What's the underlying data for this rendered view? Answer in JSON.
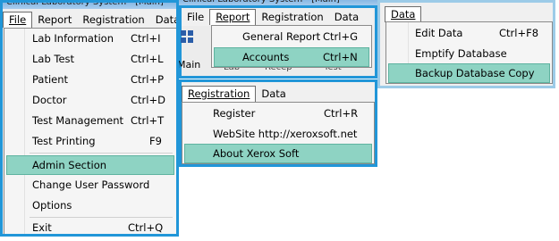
{
  "window": {
    "title": "Clinical Laboratory System - [Main]"
  },
  "menubar": {
    "file": "File",
    "report": "Report",
    "registration": "Registration",
    "data": "Data"
  },
  "file_menu": {
    "items": [
      {
        "label": "Lab Information",
        "shortcut": "Ctrl+I"
      },
      {
        "label": "Lab Test",
        "shortcut": "Ctrl+L"
      },
      {
        "label": "Patient",
        "shortcut": "Ctrl+P"
      },
      {
        "label": "Doctor",
        "shortcut": "Ctrl+D"
      },
      {
        "label": "Test Management",
        "shortcut": "Ctrl+T"
      },
      {
        "label": "Test Printing",
        "shortcut": "F9"
      },
      {
        "label": "Admin Section",
        "shortcut": ""
      },
      {
        "label": "Change User Password",
        "shortcut": ""
      },
      {
        "label": "Options",
        "shortcut": ""
      },
      {
        "label": "Exit",
        "shortcut": "Ctrl+Q"
      }
    ]
  },
  "report_menu": {
    "items": [
      {
        "label": "General Report",
        "shortcut": "Ctrl+G"
      },
      {
        "label": "Accounts",
        "shortcut": "Ctrl+N"
      }
    ]
  },
  "registration_menu": {
    "items": [
      {
        "label": "Register",
        "shortcut": "Ctrl+R"
      },
      {
        "label": "WebSite http://xeroxsoft.net",
        "shortcut": ""
      },
      {
        "label": "About Xerox Soft",
        "shortcut": ""
      }
    ]
  },
  "data_menu": {
    "items": [
      {
        "label": "Edit Data",
        "shortcut": "Ctrl+F8"
      },
      {
        "label": "Emptify Database",
        "shortcut": ""
      },
      {
        "label": "Backup Database Copy",
        "shortcut": ""
      }
    ]
  },
  "background": {
    "main_label": "Main",
    "fragments": [
      "Lab",
      "Recep",
      "Test"
    ]
  },
  "colors": {
    "highlight": "#8ed3c3",
    "outline": "#2196d8",
    "menu_bg": "#f5f5f5"
  }
}
